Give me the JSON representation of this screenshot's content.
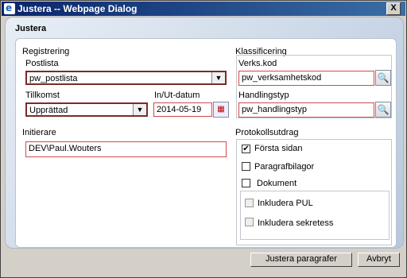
{
  "window": {
    "title": "Justera -- Webpage Dialog",
    "close_label": "X"
  },
  "header": {
    "title": "Justera"
  },
  "registrering": {
    "legend": "Registrering",
    "postlista": {
      "label": "Postlista",
      "value": "pw_postlista"
    },
    "tillkomst": {
      "label": "Tillkomst",
      "value": "Upprättad"
    },
    "datum": {
      "label": "In/Ut-datum",
      "value": "2014-05-19"
    },
    "initierare": {
      "label": "Initierare",
      "value": "DEV\\Paul.Wouters"
    }
  },
  "klassificering": {
    "legend": "Klassificering",
    "verkskod": {
      "label": "Verks.kod",
      "value": "pw_verksamhetskod"
    },
    "handlingstyp": {
      "label": "Handlingstyp",
      "value": "pw_handlingstyp"
    }
  },
  "protokoll": {
    "legend": "Protokollsutdrag",
    "items": [
      {
        "label": "Första sidan",
        "checked": true
      },
      {
        "label": "Paragrafbilagor",
        "checked": false
      },
      {
        "label": "Dokument",
        "checked": false
      }
    ],
    "sub_items": [
      {
        "label": "Inkludera PUL",
        "checked": false
      },
      {
        "label": "Inkludera sekretess",
        "checked": false
      }
    ]
  },
  "footer": {
    "adjust_button": "Justera paragrafer",
    "cancel_button": "Avbryt"
  }
}
